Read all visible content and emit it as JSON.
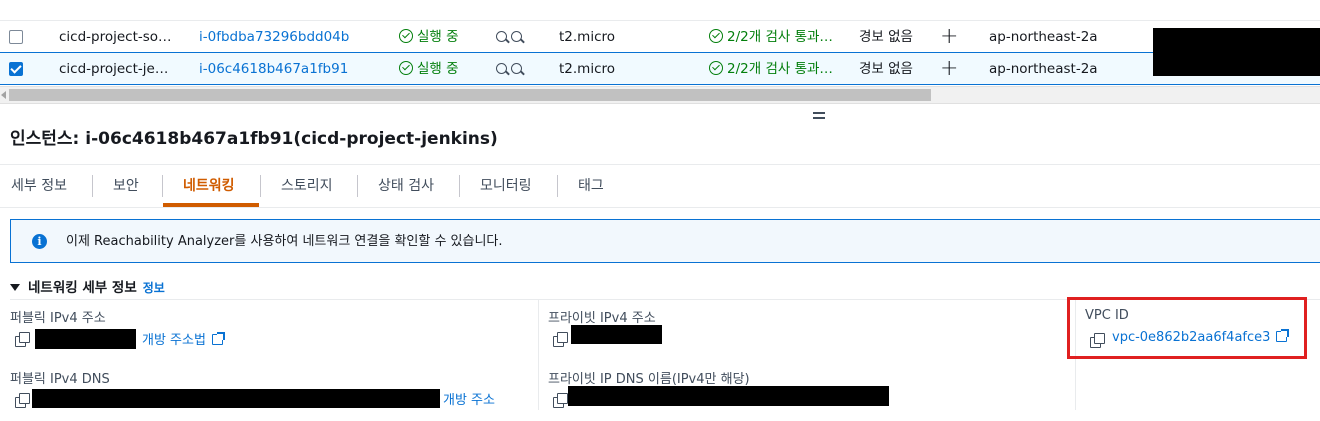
{
  "table": {
    "rows": [
      {
        "selected": false,
        "name": "cicd-project-so…",
        "instance_id": "i-0fbdba73296bdd04b",
        "state": "실행 중",
        "type": "t2.micro",
        "status_check": "2/2개 검사 통과…",
        "alarm": "경보 없음",
        "plus": "+",
        "az": "ap-northeast-2a"
      },
      {
        "selected": true,
        "name": "cicd-project-je…",
        "instance_id": "i-06c4618b467a1fb91",
        "state": "실행 중",
        "type": "t2.micro",
        "status_check": "2/2개 검사 통과…",
        "alarm": "경보 없음",
        "plus": "+",
        "az": "ap-northeast-2a"
      }
    ]
  },
  "detail": {
    "title": "인스턴스: i-06c4618b467a1fb91(cicd-project-jenkins)",
    "tabs": [
      "세부 정보",
      "보안",
      "네트워킹",
      "스토리지",
      "상태 검사",
      "모니터링",
      "태그"
    ],
    "active_tab": "네트워킹",
    "info_banner": "이제 Reachability Analyzer를 사용하여 네트워크 연결을 확인할 수 있습니다.",
    "section_title": "네트워킹 세부 정보",
    "section_info_link": "정보",
    "fields": {
      "public_ipv4_label": "퍼블릭 IPv4 주소",
      "public_ipv4_link": "개방 주소법",
      "private_ipv4_label": "프라이빗 IPv4 주소",
      "vpc_label": "VPC ID",
      "vpc_value": "vpc-0e862b2aa6f4afce3",
      "public_dns_label": "퍼블릭 IPv4 DNS",
      "public_dns_link": "개방 주소",
      "private_dns_label": "프라이빗 IP DNS 이름(IPv4만 해당)"
    }
  },
  "colors": {
    "accent": "#0972d3",
    "success": "#037f0c",
    "active_tab": "#d05c00",
    "highlight": "#e02020"
  }
}
